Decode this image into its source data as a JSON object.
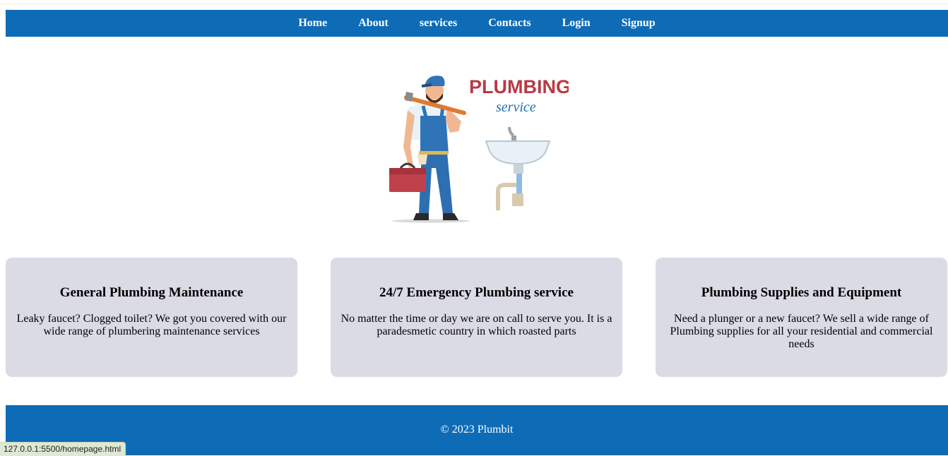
{
  "nav": {
    "items": [
      {
        "label": "Home"
      },
      {
        "label": "About"
      },
      {
        "label": "services"
      },
      {
        "label": "Contacts"
      },
      {
        "label": "Login"
      },
      {
        "label": "Signup"
      }
    ]
  },
  "hero": {
    "logo_title": "PLUMBING",
    "logo_subtitle": "service"
  },
  "cards": [
    {
      "title": "General Plumbing Maintenance",
      "text": "Leaky faucet? Clogged toilet? We got you covered with our wide range of plumbering maintenance services"
    },
    {
      "title": "24/7 Emergency Plumbing service",
      "text": "No matter the time or day we are on call to serve you. It is a paradesmetic country in which roasted parts"
    },
    {
      "title": "Plumbing Supplies and Equipment",
      "text": "Need a plunger or a new faucet? We sell a wide range of Plumbing supplies for all your residential and commercial needs"
    }
  ],
  "footer": {
    "copyright": "© 2023 Plumbit"
  },
  "status_bar": {
    "url": "127.0.0.1:5500/homepage.html"
  },
  "colors": {
    "primary": "#0e6bb6",
    "card_bg": "#dbdbe6",
    "logo_red": "#b83a45",
    "logo_blue": "#1f6fa8"
  }
}
